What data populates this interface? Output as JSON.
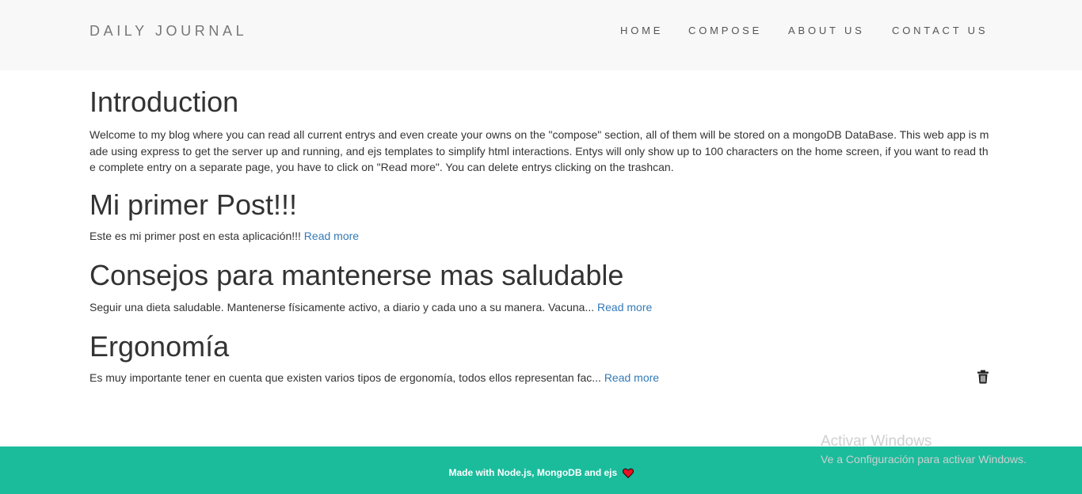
{
  "navbar": {
    "brand": "DAILY JOURNAL",
    "links": [
      "HOME",
      "COMPOSE",
      "ABOUT US",
      "CONTACT US"
    ]
  },
  "intro": {
    "title": "Introduction",
    "body": "Welcome to my blog where you can read all current entrys and even create your owns on the \"compose\" section, all of them will be stored on a mongoDB DataBase. This web app is made using express to get the server up and running, and ejs templates to simplify html interactions. Entys will only show up to 100 characters on the home screen, if you want to read the complete entry on a separate page, you have to click on \"Read more\". You can delete entrys clicking on the trashcan."
  },
  "posts": [
    {
      "title": "Mi primer Post!!!",
      "excerpt": "Este es mi primer post en esta aplicación!!!",
      "read_more": "Read more"
    },
    {
      "title": "Consejos para mantenerse mas saludable",
      "excerpt": "Seguir una dieta saludable. Mantenerse físicamente activo, a diario y cada uno a su manera. Vacuna...",
      "read_more": "Read more"
    },
    {
      "title": "Ergonomía",
      "excerpt": "Es muy importante tener en cuenta que existen varios tipos de ergonomía, todos ellos representan fac...",
      "read_more": "Read more"
    }
  ],
  "trash_icon": "trash-icon",
  "footer": {
    "text": "Made with Node.js, MongoDB and ejs",
    "icon": "heart-icon",
    "heart_color": "#e81123"
  },
  "watermark": {
    "title": "Activar Windows",
    "subtitle": "Ve a Configuración para activar Windows."
  },
  "colors": {
    "navbar_bg": "#f8f8f8",
    "footer_bg": "#1abc9c",
    "link": "#337ab7"
  }
}
